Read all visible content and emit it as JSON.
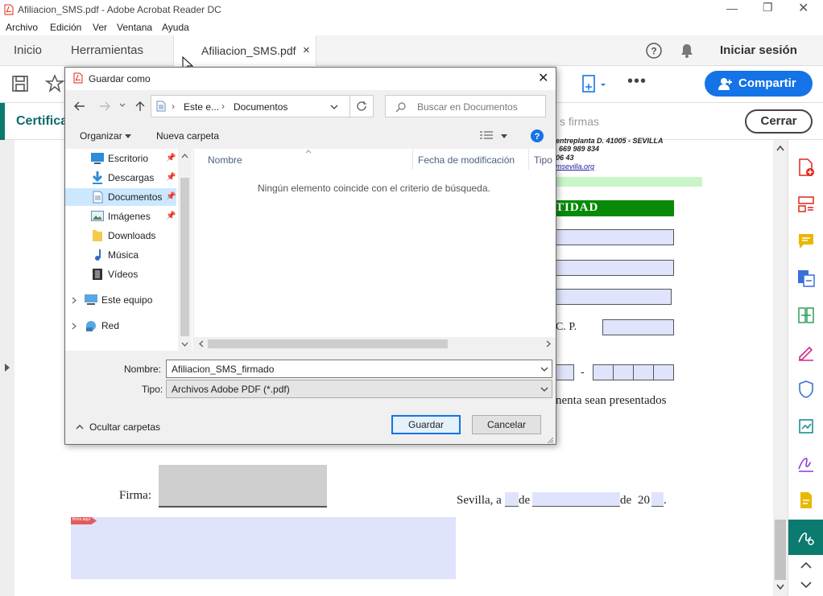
{
  "window": {
    "title": "Afiliacion_SMS.pdf - Adobe Acrobat Reader DC"
  },
  "menu": [
    "Archivo",
    "Edición",
    "Ver",
    "Ventana",
    "Ayuda"
  ],
  "tabs": {
    "home": "Inicio",
    "tools": "Herramientas",
    "document": "Afiliacion_SMS.pdf",
    "close": "×",
    "signin": "Iniciar sesión"
  },
  "toolbar": {
    "share": "Compartir"
  },
  "signbar": {
    "title": "Certifica",
    "hint": "s firmas",
    "close": "Cerrar"
  },
  "pdf": {
    "address": "entreplanta  D. 41005 - SEVILLA",
    "phone": "669 989 834",
    "phone2": "06 43",
    "web": "msevilla.org",
    "section": "TIDAD",
    "cp": "C. P.",
    "dash": "-",
    "text": "nenta sean presentados",
    "firma": "Firma:",
    "sevilla": "Sevilla, a",
    "de1": "de",
    "de2": "de",
    "year": "20",
    "dot": ".",
    "badge": "firma aqui"
  },
  "dialog": {
    "title": "Guardar como",
    "breadcrumb": [
      "Este e...",
      "Documentos"
    ],
    "search_placeholder": "Buscar en Documentos",
    "organize": "Organizar",
    "new_folder": "Nueva carpeta",
    "nav": [
      {
        "label": "Escritorio",
        "icon": "desktop-icon",
        "pinned": true
      },
      {
        "label": "Descargas",
        "icon": "download-icon",
        "pinned": true
      },
      {
        "label": "Documentos",
        "icon": "documents-icon",
        "pinned": true,
        "selected": true
      },
      {
        "label": "Imágenes",
        "icon": "pictures-icon",
        "pinned": true
      },
      {
        "label": "Downloads",
        "icon": "folder-icon",
        "pinned": false
      },
      {
        "label": "Música",
        "icon": "music-icon",
        "pinned": false
      },
      {
        "label": "Vídeos",
        "icon": "videos-icon",
        "pinned": false
      }
    ],
    "tree": [
      {
        "label": "Este equipo",
        "icon": "computer-icon"
      },
      {
        "label": "Red",
        "icon": "network-icon"
      }
    ],
    "columns": [
      "Nombre",
      "Fecha de modificación",
      "Tipo"
    ],
    "empty_message": "Ningún elemento coincide con el criterio de búsqueda.",
    "filename_label": "Nombre:",
    "filename": "Afiliacion_SMS_firmado",
    "type_label": "Tipo:",
    "type": "Archivos Adobe PDF (*.pdf)",
    "hide_folders": "Ocultar carpetas",
    "save": "Guardar",
    "cancel": "Cancelar"
  },
  "colors": {
    "accent": "#1473e6",
    "green_header": "#078a07",
    "field": "#dfe3fb",
    "purple": "#9b2fd6",
    "red": "#e1251b"
  }
}
